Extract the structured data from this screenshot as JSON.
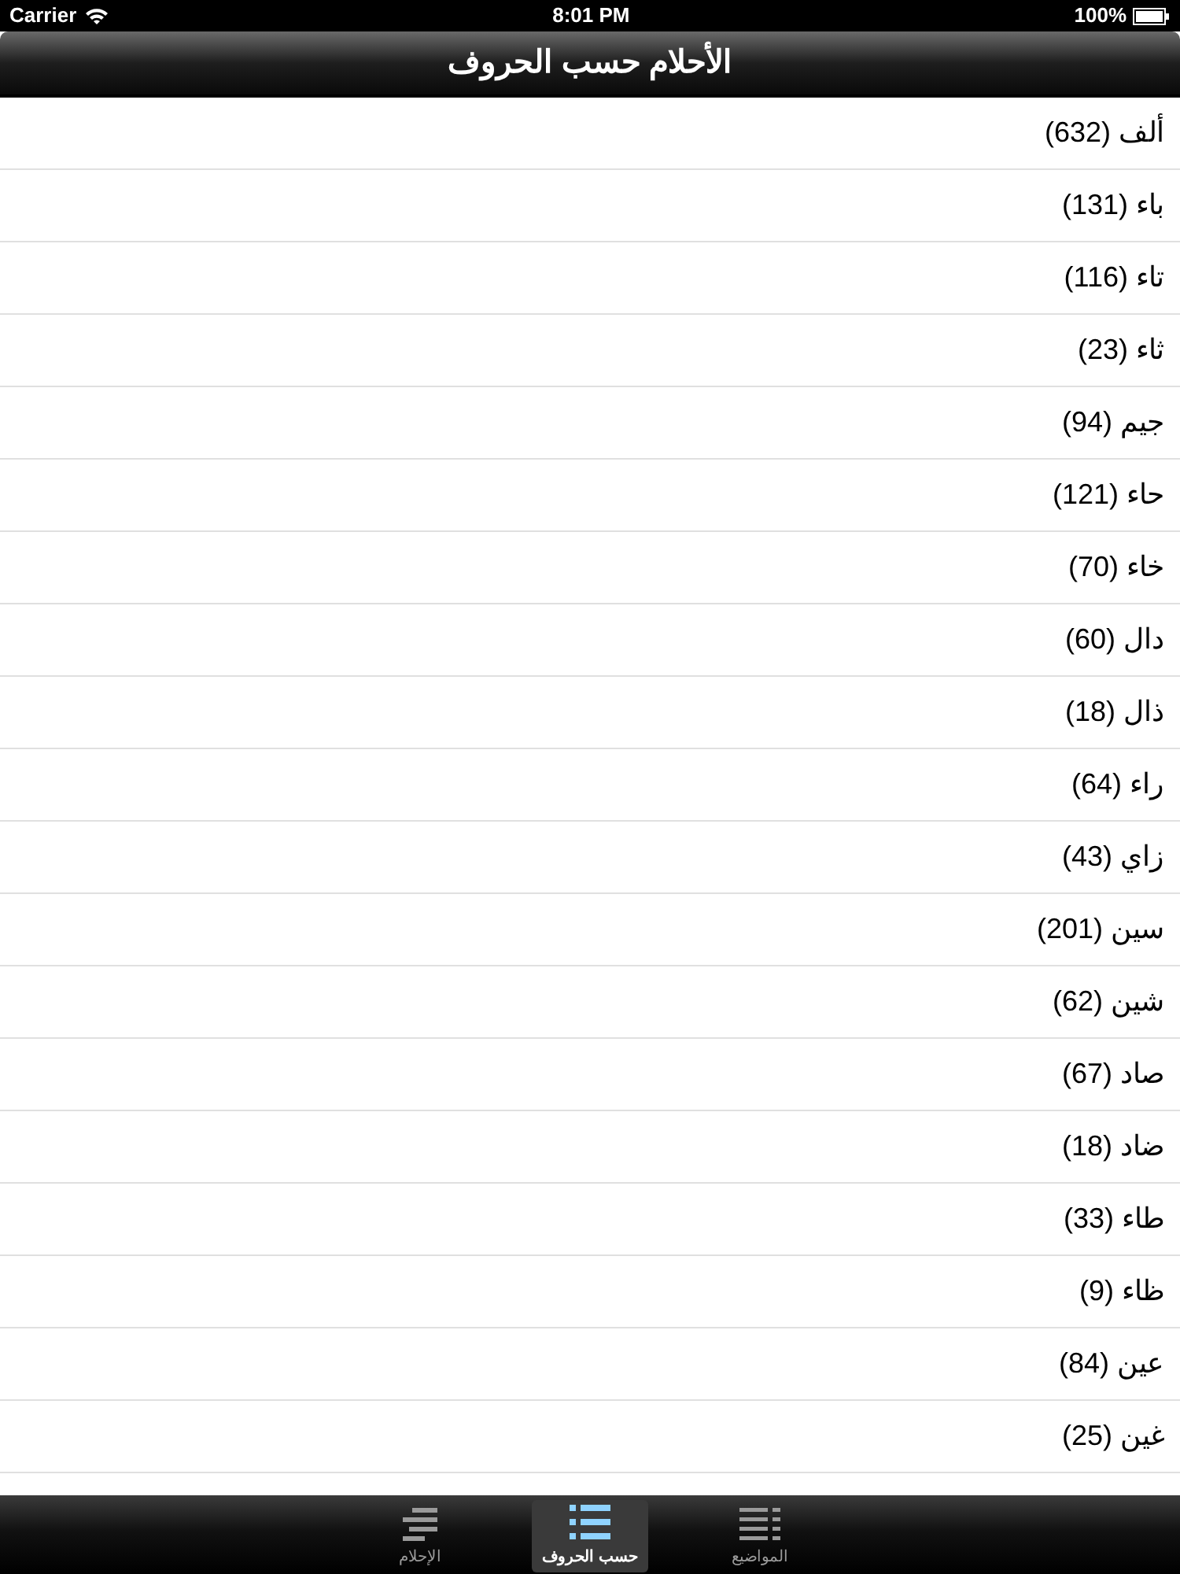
{
  "status_bar": {
    "carrier": "Carrier",
    "time": "8:01 PM",
    "battery": "100%"
  },
  "nav_bar": {
    "title": "الأحلام حسب الحروف"
  },
  "list": [
    {
      "label": "ألف (632)"
    },
    {
      "label": "باء (131)"
    },
    {
      "label": "تاء (116)"
    },
    {
      "label": "ثاء (23)"
    },
    {
      "label": "جيم (94)"
    },
    {
      "label": "حاء (121)"
    },
    {
      "label": "خاء (70)"
    },
    {
      "label": "دال (60)"
    },
    {
      "label": "ذال (18)"
    },
    {
      "label": "راء (64)"
    },
    {
      "label": "زاي (43)"
    },
    {
      "label": "سين (201)"
    },
    {
      "label": "شين (62)"
    },
    {
      "label": "صاد (67)"
    },
    {
      "label": "ضاد (18)"
    },
    {
      "label": "طاء (33)"
    },
    {
      "label": "ظاء (9)"
    },
    {
      "label": "عين (84)"
    },
    {
      "label": "غين (25)"
    }
  ],
  "tab_bar": [
    {
      "label": "المواضيع",
      "kind": "grid",
      "selected": false
    },
    {
      "label": "حسب الحروف",
      "kind": "list",
      "selected": true
    },
    {
      "label": "الإحلام",
      "kind": "lines",
      "selected": false
    }
  ]
}
